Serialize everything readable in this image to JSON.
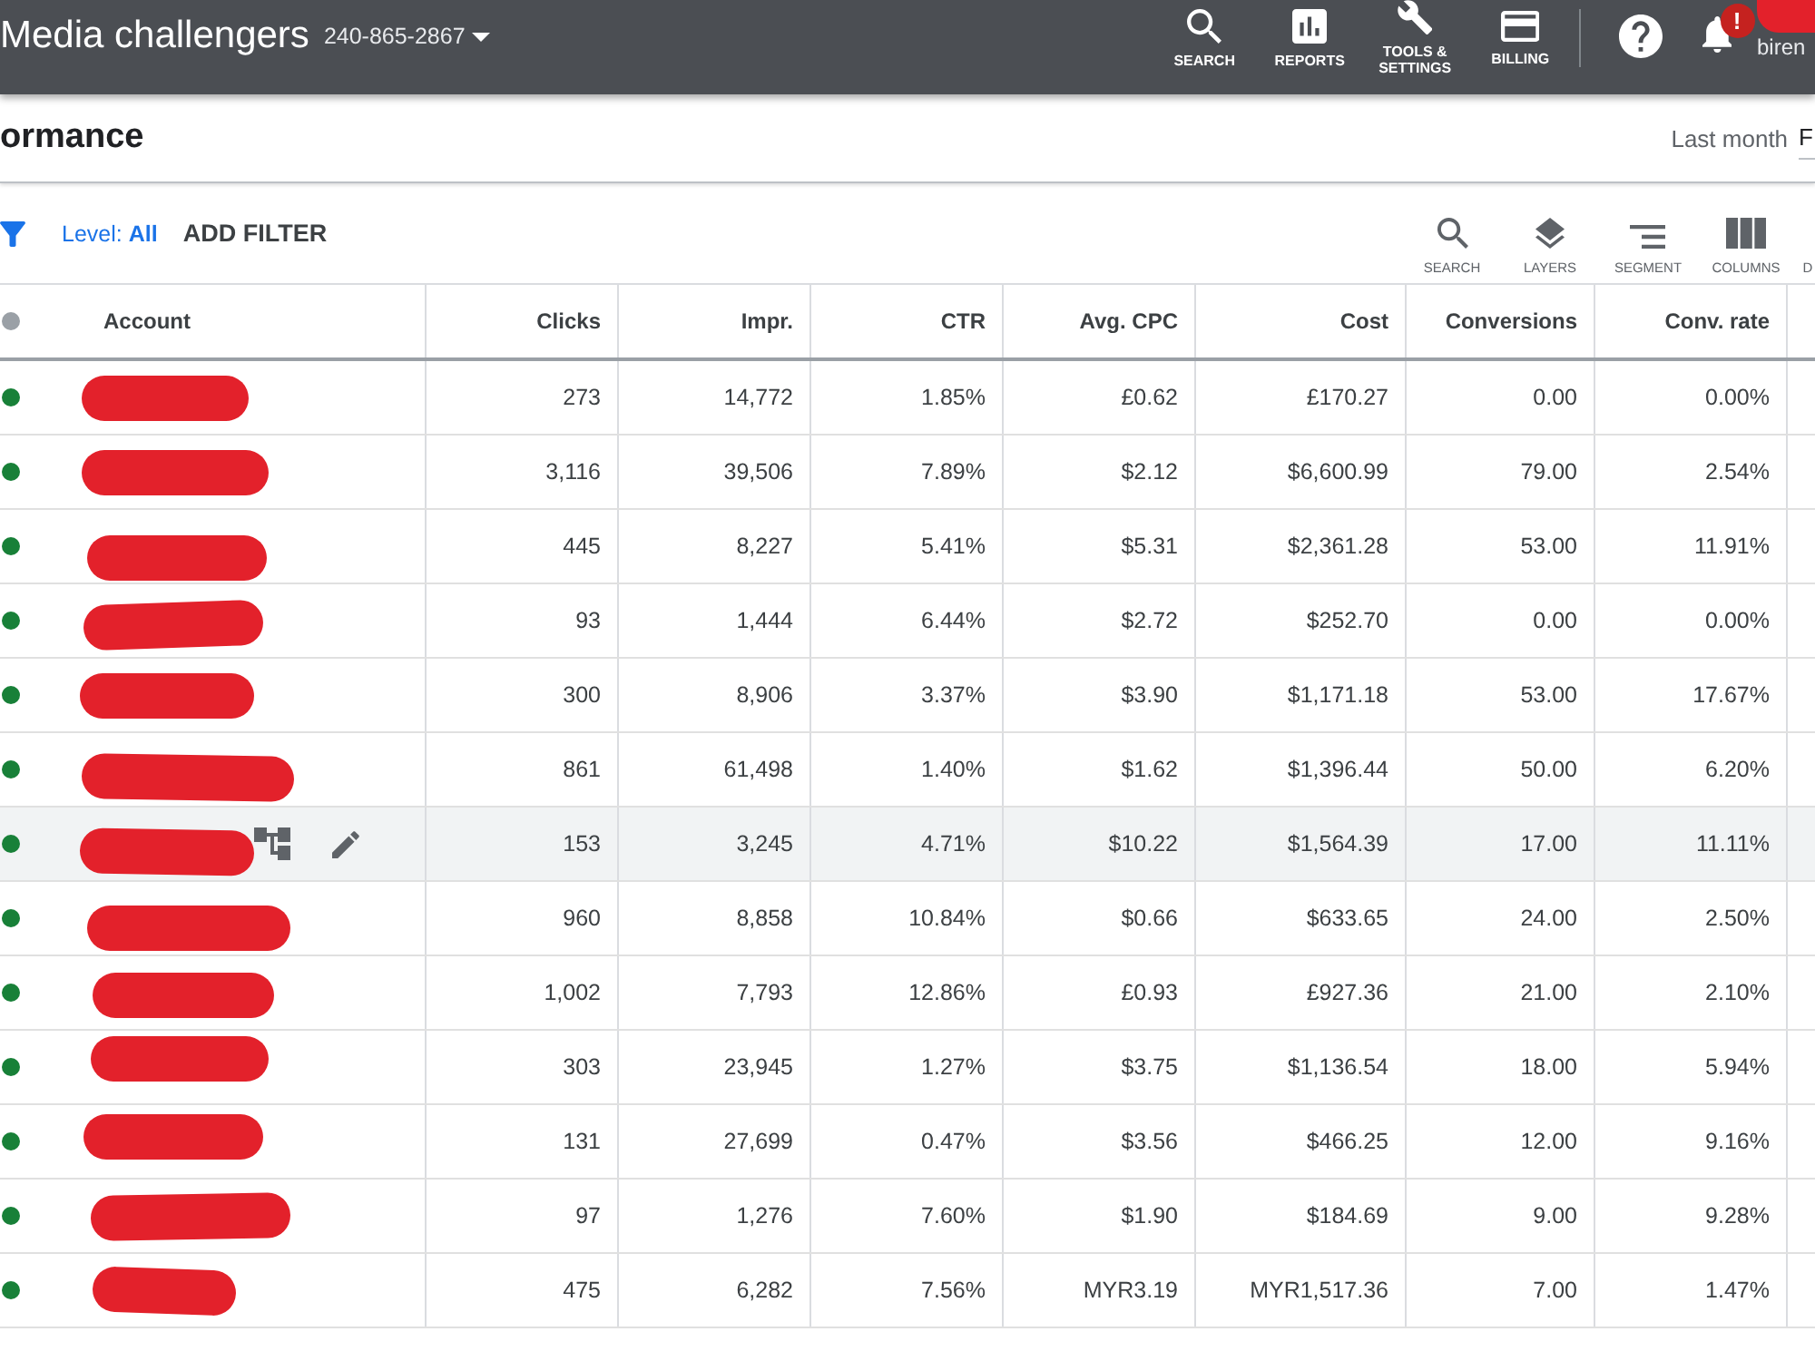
{
  "header": {
    "title": "Media challengers",
    "account_id": "240-865-2867",
    "nav": [
      {
        "kind": "search",
        "label": "SEARCH"
      },
      {
        "kind": "reports",
        "label": "REPORTS"
      },
      {
        "kind": "tools",
        "label": "TOOLS & SETTINGS"
      },
      {
        "kind": "billing",
        "label": "BILLING"
      }
    ],
    "notifications": {
      "badge": "!"
    },
    "user": {
      "name": "biren",
      "redacted": true
    }
  },
  "page": {
    "title": "ormance",
    "date_label": "Last month",
    "date_range": "F"
  },
  "filter_bar": {
    "level_filter": "Level: **All**",
    "add_filter": "ADD FILTER",
    "tools": [
      {
        "kind": "search",
        "label": "SEARCH"
      },
      {
        "kind": "layers",
        "label": "LAYERS"
      },
      {
        "kind": "segment",
        "label": "SEGMENT"
      },
      {
        "kind": "columns",
        "label": "COLUMNS"
      },
      {
        "kind": "partial",
        "label": "D"
      }
    ]
  },
  "table": {
    "columns": [
      "Account",
      "Clicks",
      "Impr.",
      "CTR",
      "Avg. CPC",
      "Cost",
      "Conversions",
      "Conv. rate"
    ],
    "rows": [
      {
        "enabled": true,
        "redacted": true,
        "highlighted": false,
        "cells": [
          "",
          "273",
          "14,772",
          "1.85%",
          "£0.62",
          "£170.27",
          "0.00",
          "0.00%"
        ]
      },
      {
        "enabled": true,
        "redacted": true,
        "highlighted": false,
        "cells": [
          "",
          "3,116",
          "39,506",
          "7.89%",
          "$2.12",
          "$6,600.99",
          "79.00",
          "2.54%"
        ]
      },
      {
        "enabled": true,
        "redacted": true,
        "highlighted": false,
        "cells": [
          "",
          "445",
          "8,227",
          "5.41%",
          "$5.31",
          "$2,361.28",
          "53.00",
          "11.91%"
        ]
      },
      {
        "enabled": true,
        "redacted": true,
        "highlighted": false,
        "cells": [
          "",
          "93",
          "1,444",
          "6.44%",
          "$2.72",
          "$252.70",
          "0.00",
          "0.00%"
        ]
      },
      {
        "enabled": true,
        "redacted": true,
        "highlighted": false,
        "cells": [
          "",
          "300",
          "8,906",
          "3.37%",
          "$3.90",
          "$1,171.18",
          "53.00",
          "17.67%"
        ]
      },
      {
        "enabled": true,
        "redacted": true,
        "highlighted": false,
        "cells": [
          "",
          "861",
          "61,498",
          "1.40%",
          "$1.62",
          "$1,396.44",
          "50.00",
          "6.20%"
        ]
      },
      {
        "enabled": true,
        "redacted": true,
        "highlighted": true,
        "cells": [
          "",
          "153",
          "3,245",
          "4.71%",
          "$10.22",
          "$1,564.39",
          "17.00",
          "11.11%"
        ]
      },
      {
        "enabled": true,
        "redacted": true,
        "highlighted": false,
        "cells": [
          "",
          "960",
          "8,858",
          "10.84%",
          "$0.66",
          "$633.65",
          "24.00",
          "2.50%"
        ]
      },
      {
        "enabled": true,
        "redacted": true,
        "highlighted": false,
        "cells": [
          "",
          "1,002",
          "7,793",
          "12.86%",
          "£0.93",
          "£927.36",
          "21.00",
          "2.10%"
        ]
      },
      {
        "enabled": true,
        "redacted": true,
        "highlighted": false,
        "cells": [
          "",
          "303",
          "23,945",
          "1.27%",
          "$3.75",
          "$1,136.54",
          "18.00",
          "5.94%"
        ]
      },
      {
        "enabled": true,
        "redacted": true,
        "highlighted": false,
        "cells": [
          "",
          "131",
          "27,699",
          "0.47%",
          "$3.56",
          "$466.25",
          "12.00",
          "9.16%"
        ]
      },
      {
        "enabled": true,
        "redacted": true,
        "highlighted": false,
        "cells": [
          "",
          "97",
          "1,276",
          "7.60%",
          "$1.90",
          "$184.69",
          "9.00",
          "9.28%"
        ]
      },
      {
        "enabled": true,
        "redacted": true,
        "highlighted": false,
        "cells": [
          "",
          "475",
          "6,282",
          "7.56%",
          "MYR3.19",
          "MYR1,517.36",
          "7.00",
          "1.47%"
        ]
      }
    ]
  }
}
